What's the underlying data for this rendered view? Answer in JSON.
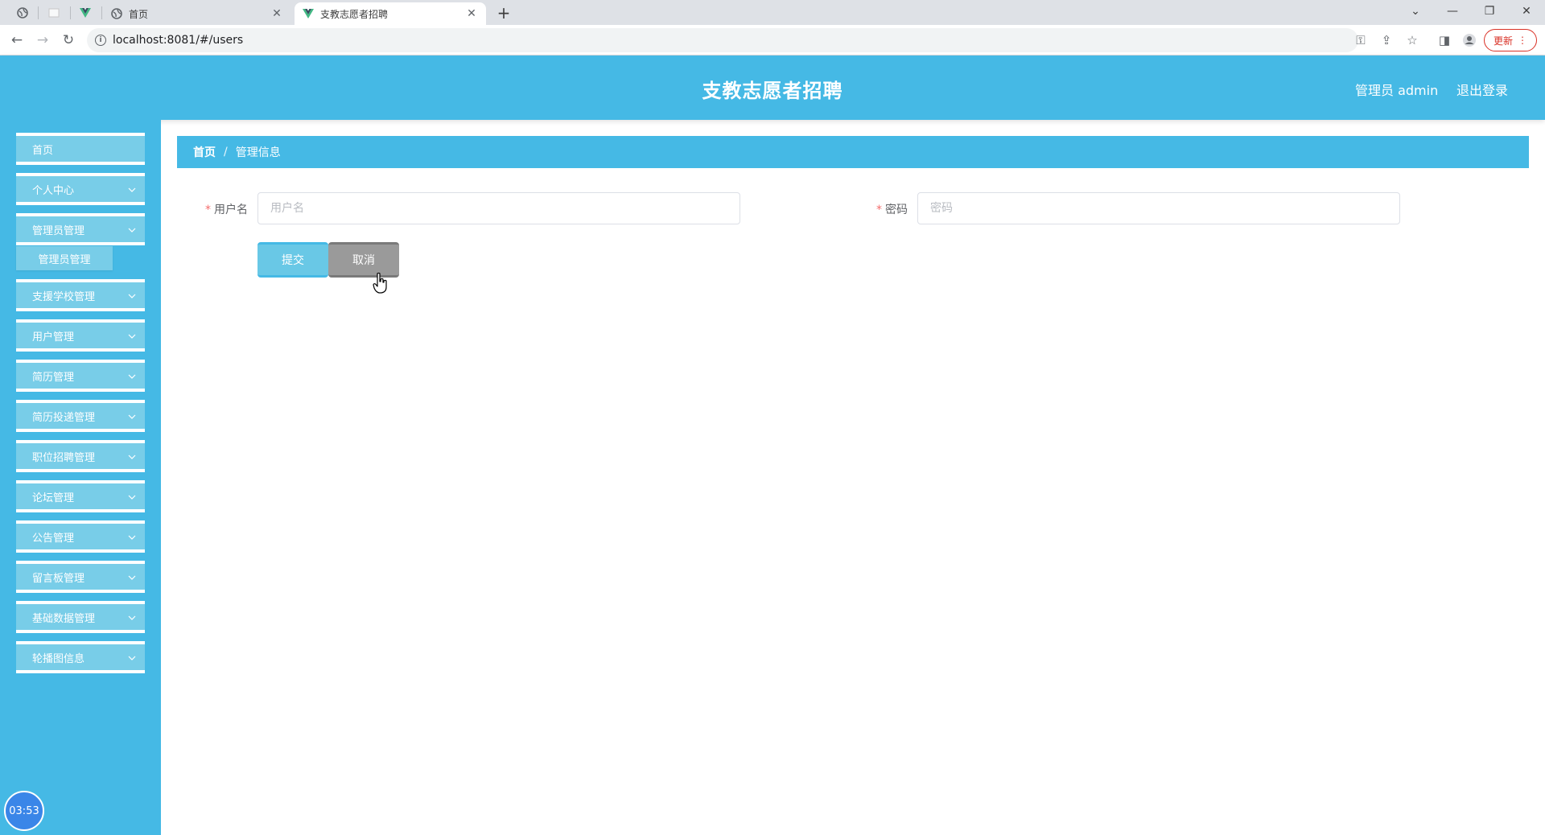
{
  "browser": {
    "tabs": [
      {
        "title": "首页",
        "icon": "globe-icon",
        "active": false
      },
      {
        "title": "支教志愿者招聘",
        "icon": "vue-logo-icon",
        "active": true
      }
    ],
    "url": "localhost:8081/#/users",
    "update_label": "更新"
  },
  "header": {
    "title": "支教志愿者招聘",
    "user_label": "管理员 admin",
    "logout_label": "退出登录"
  },
  "sidebar": {
    "items": [
      {
        "label": "首页",
        "has_children": false
      },
      {
        "label": "个人中心",
        "has_children": true
      },
      {
        "label": "管理员管理",
        "has_children": true
      },
      {
        "label": "支援学校管理",
        "has_children": true
      },
      {
        "label": "用户管理",
        "has_children": true
      },
      {
        "label": "简历管理",
        "has_children": true
      },
      {
        "label": "简历投递管理",
        "has_children": true
      },
      {
        "label": "职位招聘管理",
        "has_children": true
      },
      {
        "label": "论坛管理",
        "has_children": true
      },
      {
        "label": "公告管理",
        "has_children": true
      },
      {
        "label": "留言板管理",
        "has_children": true
      },
      {
        "label": "基础数据管理",
        "has_children": true
      },
      {
        "label": "轮播图信息",
        "has_children": true
      }
    ],
    "submenu": {
      "label": "管理员管理"
    },
    "clock": "03:53"
  },
  "breadcrumb": {
    "home": "首页",
    "separator": "/",
    "current": "管理信息"
  },
  "form": {
    "username": {
      "label": "用户名",
      "placeholder": "用户名",
      "value": ""
    },
    "password": {
      "label": "密码",
      "placeholder": "密码",
      "value": ""
    },
    "submit_label": "提交",
    "cancel_label": "取消"
  },
  "colors": {
    "primary": "#45b9e5",
    "menu_item": "#78cde8",
    "cancel": "#9a9a9a",
    "required": "#f56c6c"
  }
}
